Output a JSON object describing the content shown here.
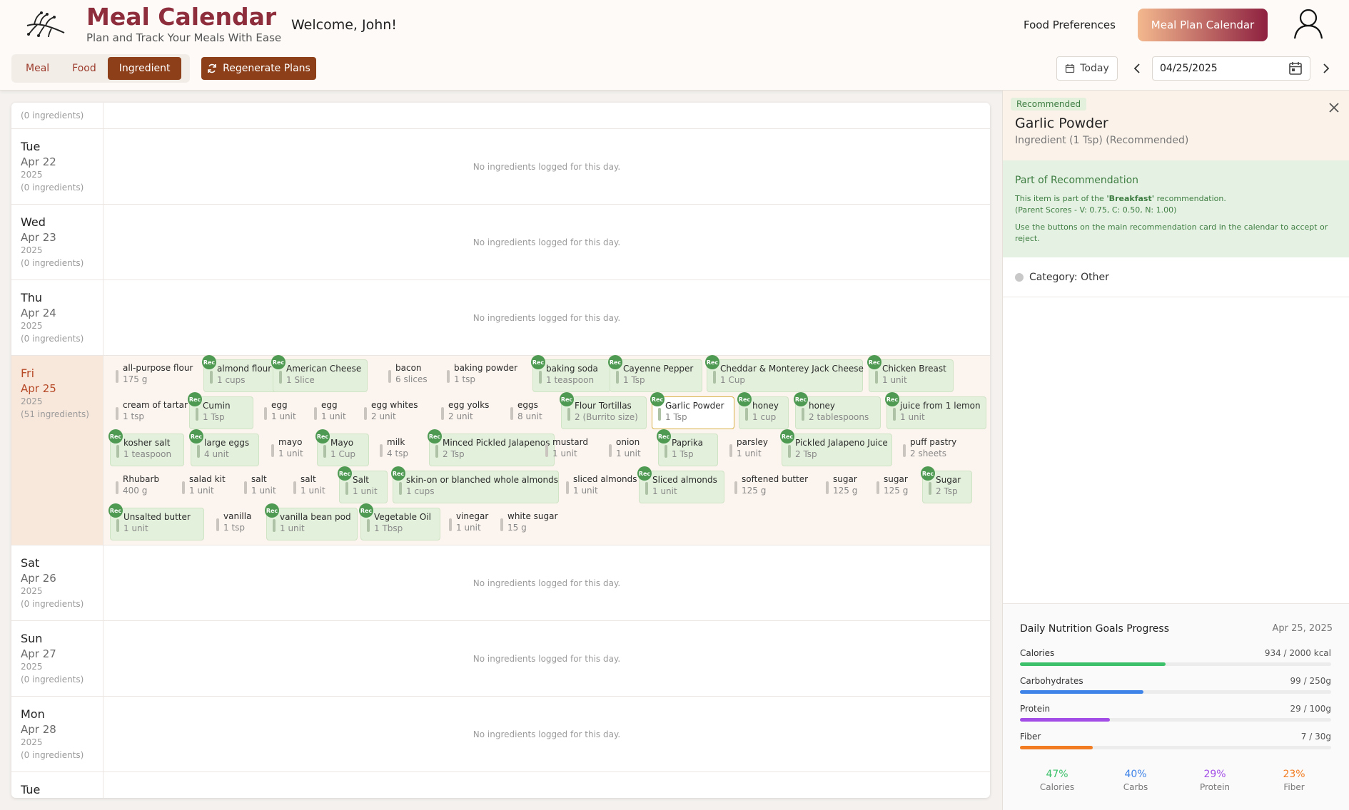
{
  "header": {
    "app_title": "Meal Calendar",
    "app_subtitle": "Plan and Track Your Meals With Ease",
    "welcome": "Welcome, John!",
    "food_preferences": "Food Preferences",
    "meal_plan_calendar": "Meal Plan Calendar"
  },
  "view_tabs": [
    {
      "label": "Meal",
      "active": false
    },
    {
      "label": "Food",
      "active": false
    },
    {
      "label": "Ingredient",
      "active": true
    }
  ],
  "regenerate_label": "Regenerate Plans",
  "today_label": "Today",
  "date_value": "04/25/2025",
  "calendar": {
    "days": [
      {
        "day": "",
        "date": "",
        "year": "",
        "count": "(0 ingredients)",
        "empty": false
      },
      {
        "day": "Tue",
        "date": "Apr 22",
        "year": "2025",
        "count": "(0 ingredients)",
        "empty": true
      },
      {
        "day": "Wed",
        "date": "Apr 23",
        "year": "2025",
        "count": "(0 ingredients)",
        "empty": true
      },
      {
        "day": "Thu",
        "date": "Apr 24",
        "year": "2025",
        "count": "(0 ingredients)",
        "empty": true
      },
      {
        "day": "Fri",
        "date": "Apr 25",
        "year": "2025",
        "count": "(51 ingredients)",
        "empty": false,
        "selected": true
      },
      {
        "day": "Sat",
        "date": "Apr 26",
        "year": "2025",
        "count": "(0 ingredients)",
        "empty": true
      },
      {
        "day": "Sun",
        "date": "Apr 27",
        "year": "2025",
        "count": "(0 ingredients)",
        "empty": true
      },
      {
        "day": "Mon",
        "date": "Apr 28",
        "year": "2025",
        "count": "(0 ingredients)",
        "empty": true
      },
      {
        "day": "Tue",
        "date": "",
        "year": "",
        "count": "",
        "empty": false
      }
    ],
    "empty_text": "No ingredients logged for this day.",
    "rec_badge": "Rec",
    "rows": [
      [
        {
          "name": "all-purpose flour",
          "qty": "175 g",
          "rec": false
        },
        {
          "name": "almond flour",
          "qty": "1 cups",
          "rec": true
        },
        {
          "name": "American Cheese",
          "qty": "1 Slice",
          "rec": true
        },
        {
          "name": "bacon",
          "qty": "6 slices",
          "rec": false
        },
        {
          "name": "baking powder",
          "qty": "1 tsp",
          "rec": false
        },
        {
          "name": "baking soda",
          "qty": "1 teaspoon",
          "rec": true
        },
        {
          "name": "Cayenne Pepper",
          "qty": "1 Tsp",
          "rec": true
        },
        {
          "name": "Cheddar & Monterey Jack Cheese",
          "qty": "1 Cup",
          "rec": true
        },
        {
          "name": "Chicken Breast",
          "qty": "1 unit",
          "rec": true
        }
      ],
      [
        {
          "name": "cream of tartar",
          "qty": "1 tsp",
          "rec": false
        },
        {
          "name": "Cumin",
          "qty": "1 Tsp",
          "rec": true
        },
        {
          "name": "egg",
          "qty": "1 unit",
          "rec": false
        },
        {
          "name": "egg",
          "qty": "1 unit",
          "rec": false
        },
        {
          "name": "egg whites",
          "qty": "2 unit",
          "rec": false
        },
        {
          "name": "egg yolks",
          "qty": "2 unit",
          "rec": false
        },
        {
          "name": "eggs",
          "qty": "8 unit",
          "rec": false
        },
        {
          "name": "Flour Tortillas",
          "qty": "2 (Burrito size)",
          "rec": true
        },
        {
          "name": "Garlic Powder",
          "qty": "1 Tsp",
          "rec": true,
          "selected": true
        },
        {
          "name": "honey",
          "qty": "1 cup",
          "rec": true
        },
        {
          "name": "honey",
          "qty": "2 tablespoons",
          "rec": true
        },
        {
          "name": "juice from 1 lemon",
          "qty": "1 unit",
          "rec": true
        }
      ],
      [
        {
          "name": "kosher salt",
          "qty": "1 teaspoon",
          "rec": true
        },
        {
          "name": "large eggs",
          "qty": "4 unit",
          "rec": true
        },
        {
          "name": "mayo",
          "qty": "1 unit",
          "rec": false
        },
        {
          "name": "Mayo",
          "qty": "1 Cup",
          "rec": true
        },
        {
          "name": "milk",
          "qty": "4 tsp",
          "rec": false
        },
        {
          "name": "Minced Pickled Jalapenos",
          "qty": "2 Tsp",
          "rec": true
        },
        {
          "name": "mustard",
          "qty": "1 unit",
          "rec": false
        },
        {
          "name": "onion",
          "qty": "1 unit",
          "rec": false
        },
        {
          "name": "Paprika",
          "qty": "1 Tsp",
          "rec": true
        },
        {
          "name": "parsley",
          "qty": "1 unit",
          "rec": false
        },
        {
          "name": "Pickled Jalapeno Juice",
          "qty": "2 Tsp",
          "rec": true
        },
        {
          "name": "puff pastry",
          "qty": "2 sheets",
          "rec": false
        }
      ],
      [
        {
          "name": "Rhubarb",
          "qty": "400 g",
          "rec": false
        },
        {
          "name": "salad kit",
          "qty": "1 unit",
          "rec": false
        },
        {
          "name": "salt",
          "qty": "1 unit",
          "rec": false
        },
        {
          "name": "salt",
          "qty": "1 unit",
          "rec": false
        },
        {
          "name": "Salt",
          "qty": "1 unit",
          "rec": true
        },
        {
          "name": "skin-on or blanched whole almonds",
          "qty": "1 cups",
          "rec": true
        },
        {
          "name": "sliced almonds",
          "qty": "1 unit",
          "rec": false
        },
        {
          "name": "Sliced almonds",
          "qty": "1 unit",
          "rec": true
        },
        {
          "name": "softened butter",
          "qty": "125 g",
          "rec": false
        },
        {
          "name": "sugar",
          "qty": "125 g",
          "rec": false
        },
        {
          "name": "sugar",
          "qty": "125 g",
          "rec": false
        },
        {
          "name": "Sugar",
          "qty": "2 Tsp",
          "rec": true
        }
      ],
      [
        {
          "name": "Unsalted butter",
          "qty": "1 unit",
          "rec": true
        },
        {
          "name": "vanilla",
          "qty": "1 tsp",
          "rec": false
        },
        {
          "name": "vanilla bean pod",
          "qty": "1 unit",
          "rec": true
        },
        {
          "name": "Vegetable Oil",
          "qty": "1 Tbsp",
          "rec": true
        },
        {
          "name": "vinegar",
          "qty": "1 unit",
          "rec": false
        },
        {
          "name": "white sugar",
          "qty": "15 g",
          "rec": false
        }
      ]
    ]
  },
  "panel": {
    "tag": "Recommended",
    "title": "Garlic Powder",
    "subtitle": "Ingredient (1 Tsp) (Recommended)",
    "part_title": "Part of Recommendation",
    "part_line_prefix": "This item is part of the ",
    "part_line_name": "'Breakfast'",
    "part_line_suffix": " recommendation.",
    "scores": "(Parent Scores - V: 0.75, C: 0.50, N: 1.00)",
    "instruction": "Use the buttons on the main recommendation card in the calendar to accept or reject.",
    "category": "Category: Other",
    "nutrition": {
      "title": "Daily Nutrition Goals Progress",
      "date": "Apr 25, 2025",
      "rows": [
        {
          "label": "Calories",
          "value": "934 / 2000 kcal",
          "fraction": 0.467,
          "color": "#3cc16a"
        },
        {
          "label": "Carbohydrates",
          "value": "99 / 250g",
          "fraction": 0.396,
          "color": "#3d83e8"
        },
        {
          "label": "Protein",
          "value": "29 / 100g",
          "fraction": 0.29,
          "color": "#a24ee6"
        },
        {
          "label": "Fiber",
          "value": "7 / 30g",
          "fraction": 0.233,
          "color": "#f27c22"
        }
      ],
      "percents": [
        {
          "value": "47%",
          "label": "Calories",
          "color": "#3cc16a"
        },
        {
          "value": "40%",
          "label": "Carbs",
          "color": "#3d83e8"
        },
        {
          "value": "29%",
          "label": "Protein",
          "color": "#a24ee6"
        },
        {
          "value": "23%",
          "label": "Fiber",
          "color": "#f27c22"
        }
      ]
    }
  }
}
